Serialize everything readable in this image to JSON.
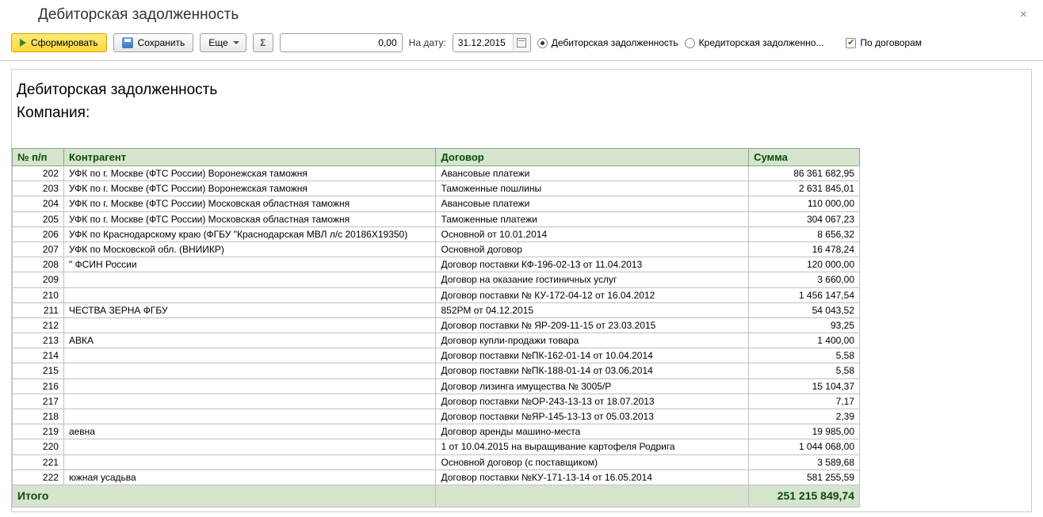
{
  "window": {
    "title": "Дебиторская задолженность",
    "close": "×"
  },
  "toolbar": {
    "generate": "Сформировать",
    "save": "Сохранить",
    "more": "Еще",
    "sigma": "Σ",
    "num_value": "0,00",
    "date_label": "На дату:",
    "date_value": "31.12.2015",
    "radio_debit": "Дебиторская задолженность",
    "radio_credit": "Кредиторская задолженно...",
    "check_contracts": "По договорам"
  },
  "report": {
    "title": "Дебиторская задолженность",
    "company_label": "Компания:",
    "headers": {
      "n": "№ п/п",
      "contractor": "Контрагент",
      "contract": "Договор",
      "sum": "Сумма"
    },
    "rows": [
      {
        "n": "202",
        "c": "УФК по г. Москве (ФТС России) Воронежская таможня",
        "d": "Авансовые платежи",
        "s": "86 361 682,95"
      },
      {
        "n": "203",
        "c": "УФК по г. Москве (ФТС России) Воронежская таможня",
        "d": "Таможенные пошлины",
        "s": "2 631 845,01"
      },
      {
        "n": "204",
        "c": "УФК по г. Москве (ФТС России) Московская областная таможня",
        "d": "Авансовые платежи",
        "s": "110 000,00"
      },
      {
        "n": "205",
        "c": "УФК по г. Москве (ФТС России) Московская областная таможня",
        "d": "Таможенные платежи",
        "s": "304 067,23"
      },
      {
        "n": "206",
        "c": "УФК по Краснодарскому краю (ФГБУ \"Краснодарская МВЛ л/с 20186Х19350)",
        "d": "Основной от 10.01.2014",
        "s": "8 656,32"
      },
      {
        "n": "207",
        "c": "УФК по Московской обл. (ВНИИКР)",
        "d": "Основной договор",
        "s": "16 478,24"
      },
      {
        "n": "208",
        "c": "                          \" ФСИН России",
        "d": "Договор поставки КФ-196-02-13 от 11.04.2013",
        "s": "120 000,00"
      },
      {
        "n": "209",
        "c": "",
        "d": "Договор на оказание гостиничных услуг",
        "s": "3 660,00"
      },
      {
        "n": "210",
        "c": "",
        "d": "Договор поставки № КУ-172-04-12 от 16.04.2012",
        "s": "1 456 147,54"
      },
      {
        "n": "211",
        "c": "                         ЧЕСТВА ЗЕРНА ФГБУ",
        "d": "852РМ от 04.12.2015",
        "s": "54 043,52"
      },
      {
        "n": "212",
        "c": "",
        "d": "Договор поставки № ЯР-209-11-15 от 23.03.2015",
        "s": "93,25"
      },
      {
        "n": "213",
        "c": "                         АВКА",
        "d": "Договор купли-продажи товара",
        "s": "1 400,00"
      },
      {
        "n": "214",
        "c": "",
        "d": "Договор поставки №ПК-162-01-14 от 10.04.2014",
        "s": "5,58"
      },
      {
        "n": "215",
        "c": "",
        "d": "Договор поставки №ПК-188-01-14 от 03.06.2014",
        "s": "5,58"
      },
      {
        "n": "216",
        "c": "",
        "d": "Договор лизинга имущества № 3005/Р",
        "s": "15 104,37"
      },
      {
        "n": "217",
        "c": "",
        "d": "Договор поставки №ОР-243-13-13 от 18.07.2013",
        "s": "7,17"
      },
      {
        "n": "218",
        "c": "",
        "d": "Договор поставки №ЯР-145-13-13 от 05.03.2013",
        "s": "2,39"
      },
      {
        "n": "219",
        "c": "                         аевна",
        "d": "Договор аренды машино-места",
        "s": "19 985,00"
      },
      {
        "n": "220",
        "c": "",
        "d": "1 от 10.04.2015 на выращивание картофеля Родрига",
        "s": "1 044 068,00"
      },
      {
        "n": "221",
        "c": "",
        "d": "Основной договор (с поставщиком)",
        "s": "3 589,68"
      },
      {
        "n": "222",
        "c": "южная усадьва",
        "d": "Договор поставки №КУ-171-13-14 от 16.05.2014",
        "s": "581 255,59"
      }
    ],
    "total_label": "Итого",
    "total_sum": "251 215 849,74"
  }
}
